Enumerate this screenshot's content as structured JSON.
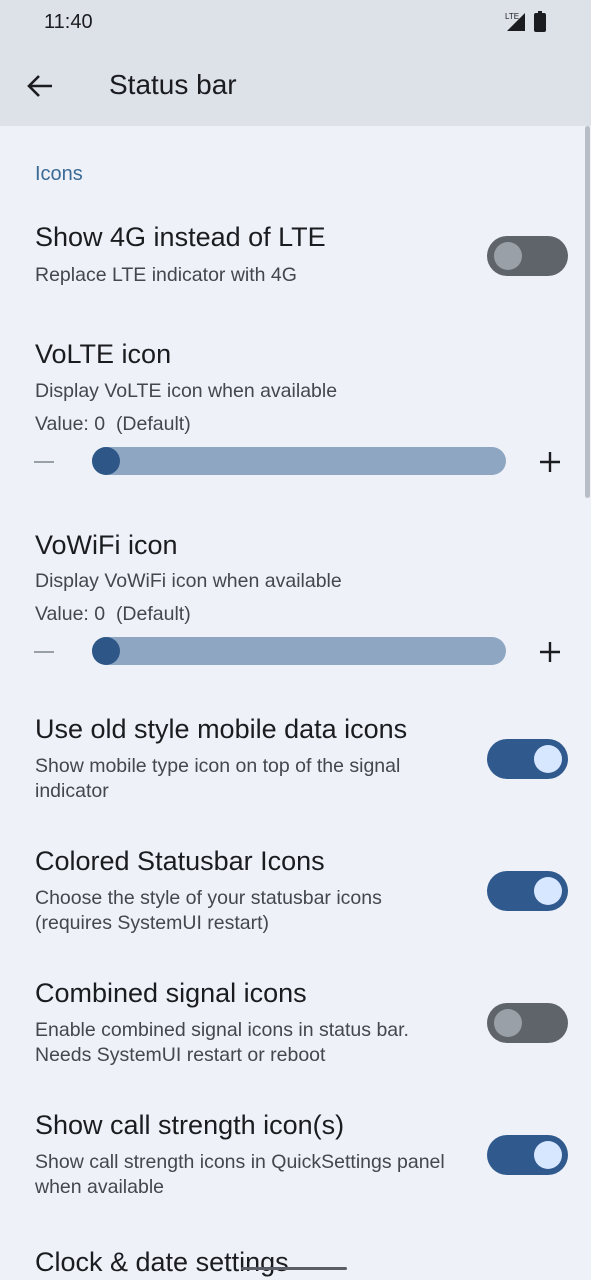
{
  "status_bar": {
    "time": "11:40",
    "network_label": "LTE"
  },
  "app_bar": {
    "title": "Status bar"
  },
  "category": "Icons",
  "prefs": [
    {
      "title": "Show 4G instead of LTE",
      "summary": "Replace LTE indicator with 4G",
      "toggle": false
    },
    {
      "title": "VoLTE icon",
      "summary": "Display VoLTE icon when available",
      "value_text": "Value: 0  (Default)",
      "slider_fraction": 0
    },
    {
      "title": "VoWiFi icon",
      "summary": "Display VoWiFi icon when available",
      "value_text": "Value: 0  (Default)",
      "slider_fraction": 0
    },
    {
      "title": "Use old style mobile data icons",
      "summary": "Show mobile type icon on top of the signal indicator",
      "toggle": true
    },
    {
      "title": "Colored Statusbar Icons",
      "summary": "Choose the style of your statusbar icons (requires SystemUI restart)",
      "toggle": true
    },
    {
      "title": "Combined signal icons",
      "summary": "Enable combined signal icons in status bar. Needs SystemUI restart or reboot",
      "toggle": false
    },
    {
      "title": "Show call strength icon(s)",
      "summary": "Show call strength icons in QuickSettings panel when available",
      "toggle": true
    },
    {
      "title": "Clock & date settings"
    }
  ],
  "icons": {
    "back": "arrow-back-icon",
    "signal": "signal-lte-icon",
    "battery": "battery-icon",
    "minus": "minus-icon",
    "plus": "plus-icon"
  },
  "colors": {
    "background": "#eef1f7",
    "app_bar": "#dde1e8",
    "accent": "#305a8d",
    "category": "#3a6b97",
    "toggle_off": "#5f646b"
  }
}
